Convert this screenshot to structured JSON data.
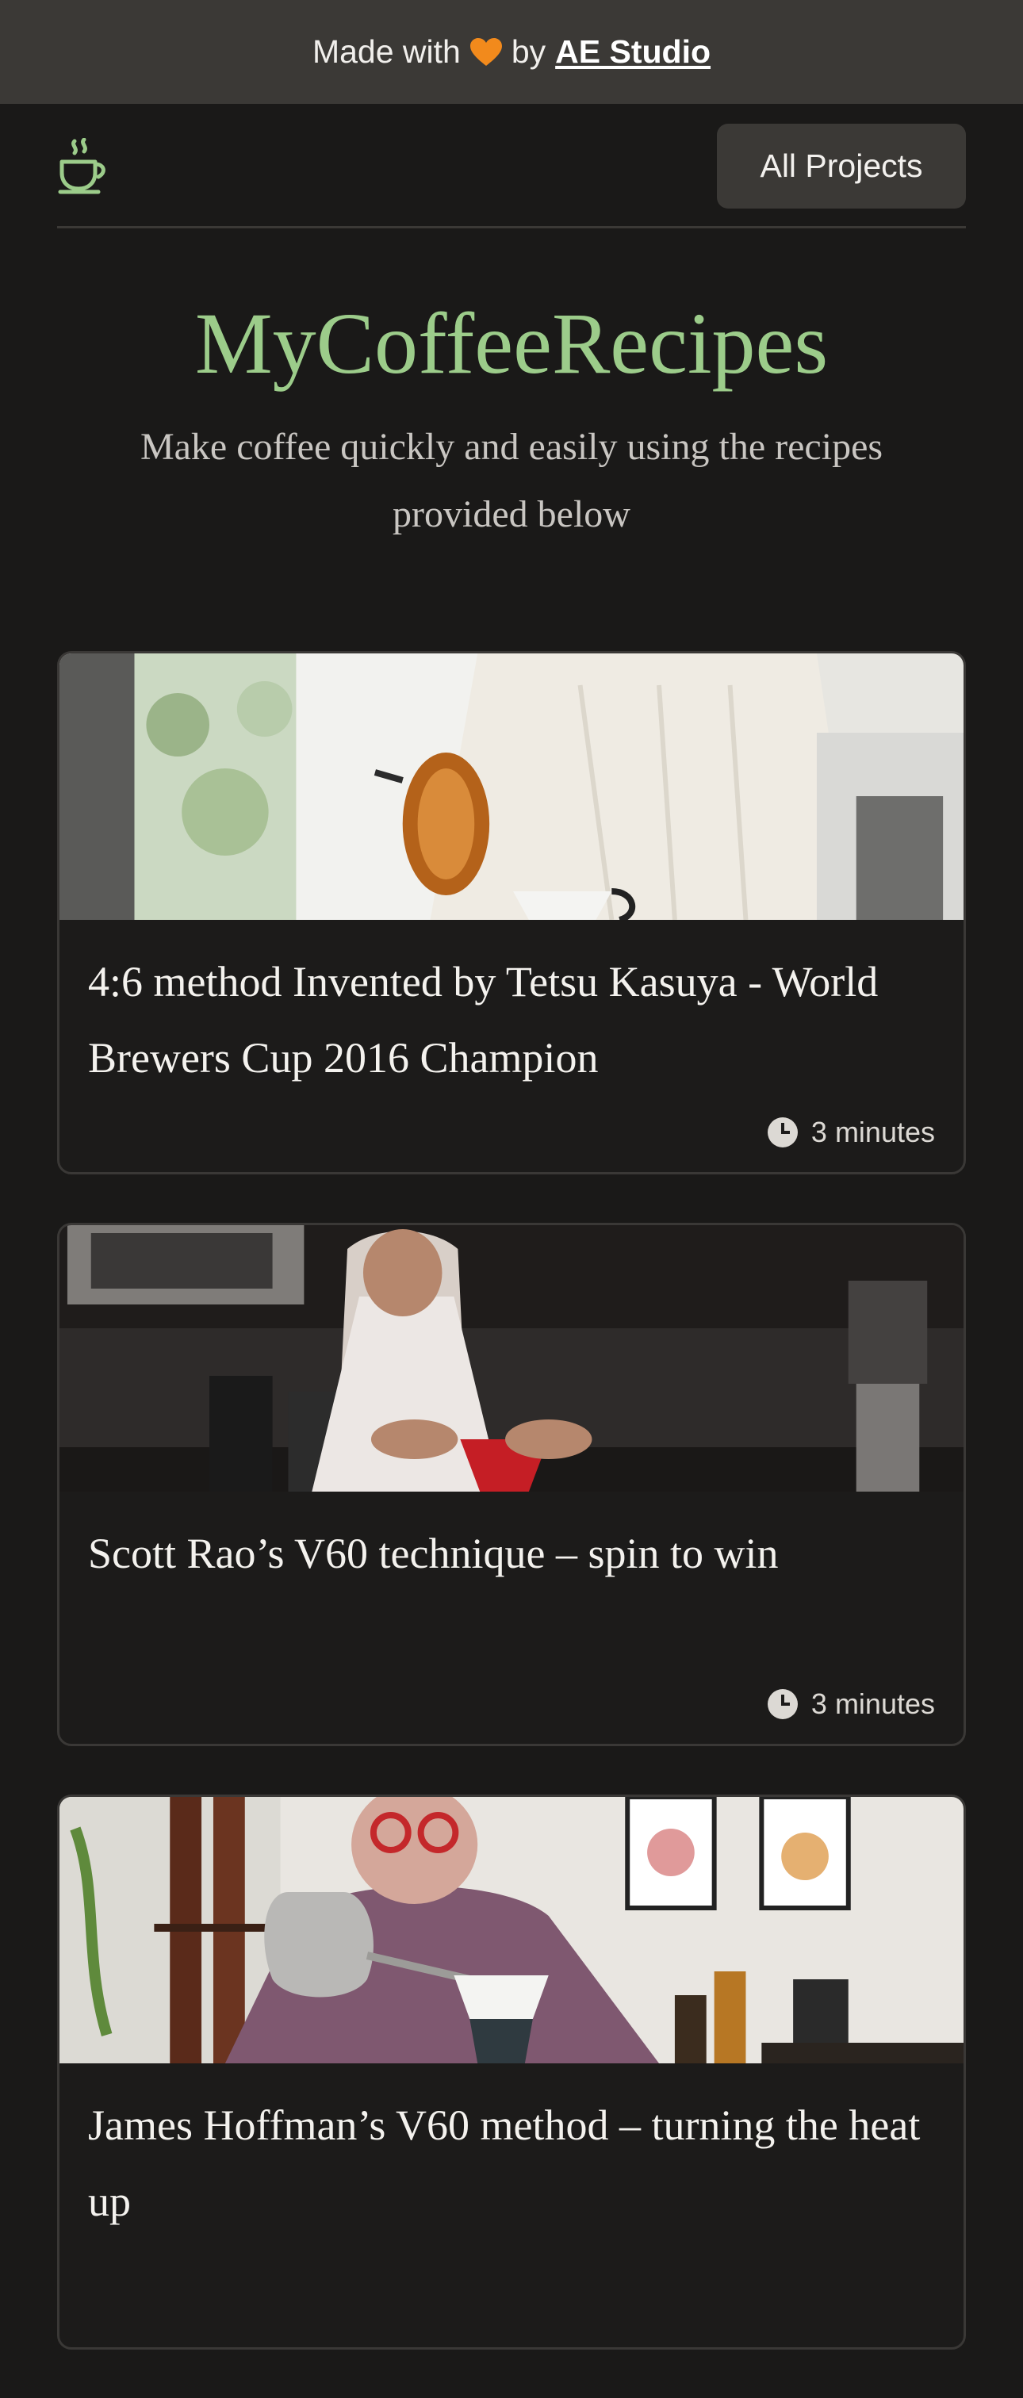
{
  "banner": {
    "made_with": "Made with",
    "by": "by",
    "studio_link": "AE Studio",
    "heart_icon": "orange-heart-icon"
  },
  "nav": {
    "logo_icon": "coffee-cup-icon",
    "all_projects_label": "All Projects"
  },
  "hero": {
    "title": "MyCoffeeRecipes",
    "subtitle": "Make coffee quickly and easily using the recipes provided below"
  },
  "recipes": [
    {
      "title": "4:6 method Invented by Tetsu Kasuya - World Brewers Cup 2016 Champion",
      "time": "3 minutes"
    },
    {
      "title": "Scott Rao’s V60 technique – spin to win",
      "time": "3 minutes"
    },
    {
      "title": "James Hoffman’s V60 method – turning the heat up",
      "time": ""
    }
  ],
  "colors": {
    "background": "#1a1918",
    "banner": "#3b3936",
    "accent_green": "#9ccc8a",
    "heart": "#f28a1c"
  }
}
